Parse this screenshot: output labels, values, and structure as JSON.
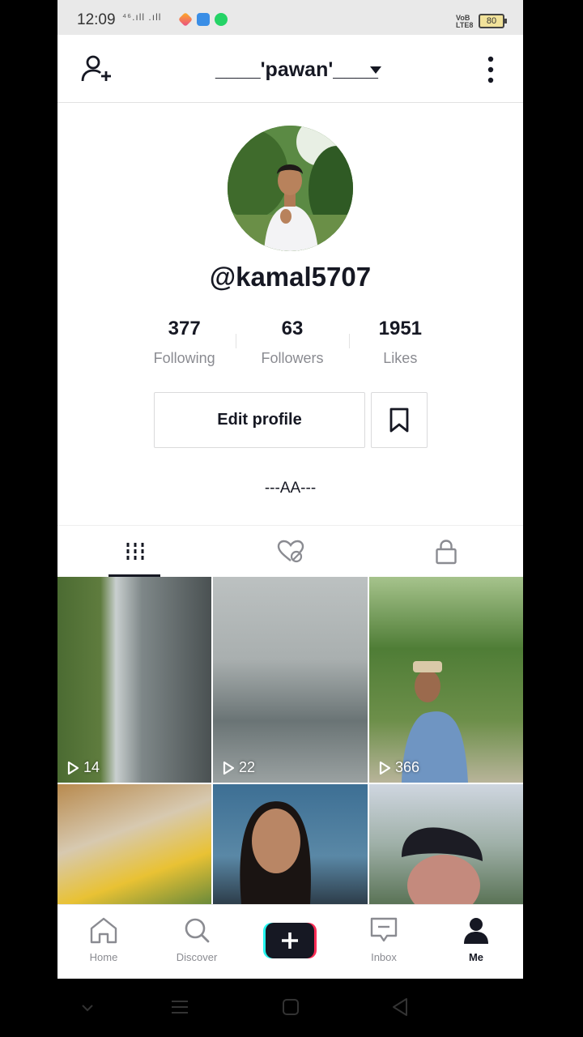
{
  "status_bar": {
    "time": "12:09",
    "signal": "⁴⁶.ıll .ıll",
    "volte": "VoB LTE8",
    "battery": "80"
  },
  "header": {
    "username": "____'pawan'____"
  },
  "profile": {
    "handle": "@kamal5707",
    "stats": [
      {
        "value": "377",
        "label": "Following"
      },
      {
        "value": "63",
        "label": "Followers"
      },
      {
        "value": "1951",
        "label": "Likes"
      }
    ],
    "edit_label": "Edit profile",
    "bio": "---AA---"
  },
  "tabs": {
    "selected": "videos"
  },
  "videos": [
    {
      "views": "14"
    },
    {
      "views": "22"
    },
    {
      "views": "366"
    },
    {
      "views": ""
    },
    {
      "views": ""
    },
    {
      "views": ""
    }
  ],
  "nav": {
    "home": "Home",
    "discover": "Discover",
    "inbox": "Inbox",
    "me": "Me"
  },
  "colors": {
    "text": "#161823",
    "muted": "#8a8b91",
    "accent_cyan": "#25f4ee",
    "accent_pink": "#fe2c55"
  }
}
